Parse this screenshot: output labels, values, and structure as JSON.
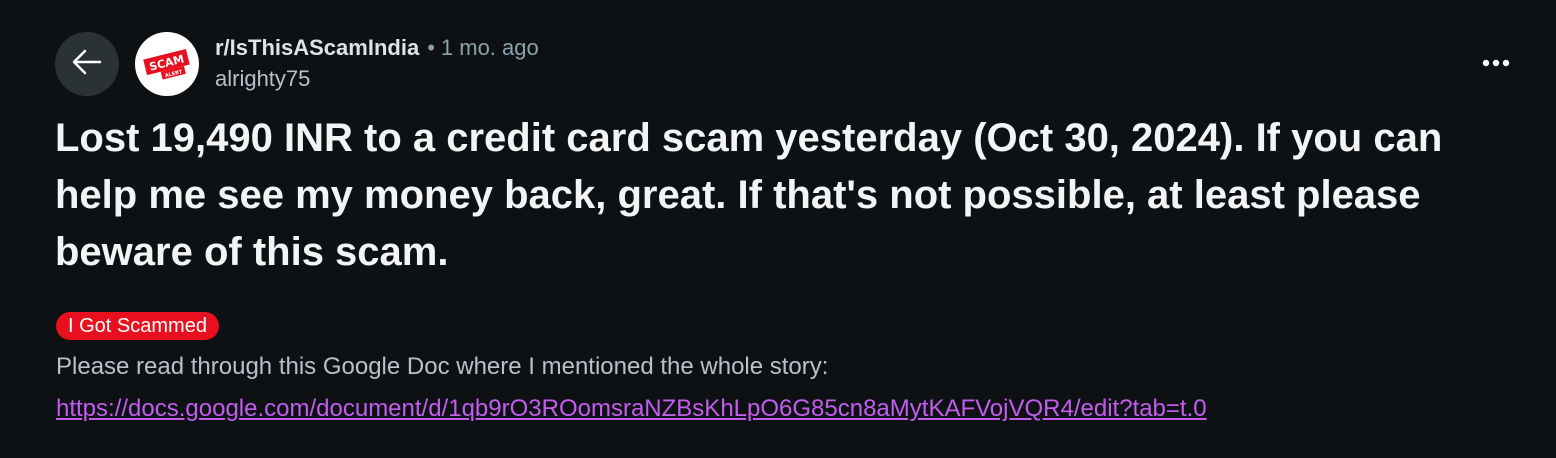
{
  "header": {
    "back_icon": "arrow-left-icon",
    "avatar_badge_text": "SCAM",
    "avatar_badge_subtext": "ALERT",
    "subreddit": "r/IsThisAScamIndia",
    "separator": "•",
    "age": "1 mo. ago",
    "author": "alrighty75",
    "more_icon": "more-horizontal-icon"
  },
  "post": {
    "title": "Lost 19,490 INR to a credit card scam yesterday (Oct 30, 2024). If you can help me see my money back, great. If that's not possible, at least please beware of this scam.",
    "flair": "I Got Scammed",
    "body_text": "Please read through this Google Doc where I mentioned the whole story:",
    "body_link": "https://docs.google.com/document/d/1qb9rO3ROomsraNZBsKhLpO6G85cn8aMytKAFVojVQR4/edit?tab=t.0"
  },
  "colors": {
    "background": "#0e1113",
    "back_button_bg": "#2a3236",
    "flair_bg": "#e8101e",
    "link": "#c45cf0",
    "muted_text": "#8ba2ad"
  }
}
